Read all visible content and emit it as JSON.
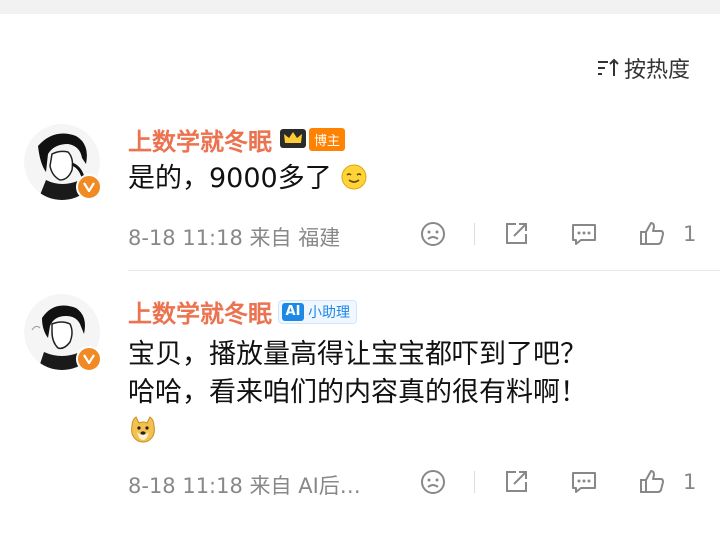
{
  "sort": {
    "label": "按热度"
  },
  "comments": [
    {
      "name": "上数学就冬眠",
      "badge": "博主",
      "badge_type": "crown",
      "text_lines": [
        "是的，9000多了"
      ],
      "meta": "8-18 11:18 来自 福建",
      "likes": "1"
    },
    {
      "name": "上数学就冬眠",
      "badge": "小助理",
      "badge_logo": "AI",
      "badge_type": "ai",
      "text_lines": [
        "宝贝，播放量高得让宝宝都吓到了吧？",
        "哈哈，看来咱们的内容真的很有料啊！"
      ],
      "meta": "8-18 11:18 来自 AI后…",
      "likes": "1"
    }
  ],
  "colors": {
    "name": "#eb7350",
    "badge_boss": "#ff8200",
    "ai_blue": "#1e88e5",
    "verified": "#f08a24"
  },
  "icons": [
    "sort-icon",
    "verified-v-icon",
    "crown-icon",
    "smile-emoji-icon",
    "doge-emoji-icon",
    "dislike-face-icon",
    "share-icon",
    "comment-icon",
    "like-thumb-icon"
  ]
}
